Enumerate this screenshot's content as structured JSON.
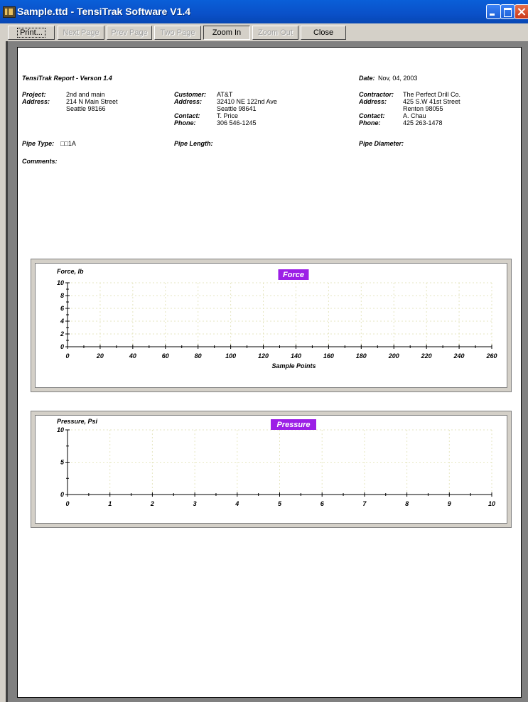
{
  "window": {
    "title": "Sample.ttd - TensiTrak Software V1.4"
  },
  "toolbar": {
    "print": "Print...",
    "next_page": "Next Page",
    "prev_page": "Prev Page",
    "two_page": "Two Page",
    "zoom_in": "Zoom In",
    "zoom_out": "Zoom Out",
    "close": "Close"
  },
  "report": {
    "heading": "TensiTrak Report - Verson 1.4",
    "date_label": "Date:",
    "date_value": "Nov, 04, 2003",
    "project_label": "Project:",
    "project_value": "2nd and main",
    "address_label": "Address:",
    "project_address_1": "214 N Main Street",
    "project_address_2": "Seattle 98166",
    "customer_label": "Customer:",
    "customer_value": "AT&T",
    "customer_address_1": "32410 NE 122nd Ave",
    "customer_address_2": "Seattle 98641",
    "contact_label": "Contact:",
    "customer_contact": "T. Price",
    "phone_label": "Phone:",
    "customer_phone": "306 546-1245",
    "contractor_label": "Contractor:",
    "contractor_value": "The Perfect Drill Co.",
    "contractor_address_1": "425 S.W 41st Street",
    "contractor_address_2": "Renton 98055",
    "contractor_contact": "A. Chau",
    "contractor_phone": "425 263-1478",
    "pipe_type_label": "Pipe Type:",
    "pipe_type_value": "□□1A",
    "pipe_length_label": "Pipe Length:",
    "pipe_diameter_label": "Pipe Diameter:",
    "comments_label": "Comments:"
  },
  "colors": {
    "chart_title_bg": "#9c1fe6",
    "chart_title_fg": "#ffffff",
    "grid": "#e6e6c0"
  },
  "chart_data": [
    {
      "type": "line",
      "title": "Force",
      "ylabel": "Force, lb",
      "xlabel": "Sample Points",
      "xlim": [
        0,
        260
      ],
      "ylim": [
        0,
        10
      ],
      "x_ticks": [
        "0",
        "20",
        "40",
        "60",
        "80",
        "100",
        "120",
        "140",
        "160",
        "180",
        "200",
        "220",
        "240",
        "260"
      ],
      "y_ticks": [
        "0",
        "2",
        "4",
        "6",
        "8",
        "10"
      ],
      "grid": true,
      "series": []
    },
    {
      "type": "line",
      "title": "Pressure",
      "ylabel": "Pressure, Psi",
      "xlabel": "",
      "xlim": [
        0,
        10
      ],
      "ylim": [
        0,
        10
      ],
      "x_ticks": [
        "0",
        "1",
        "2",
        "3",
        "4",
        "5",
        "6",
        "7",
        "8",
        "9",
        "10"
      ],
      "y_ticks": [
        "0",
        "5",
        "10"
      ],
      "grid": true,
      "series": []
    }
  ]
}
